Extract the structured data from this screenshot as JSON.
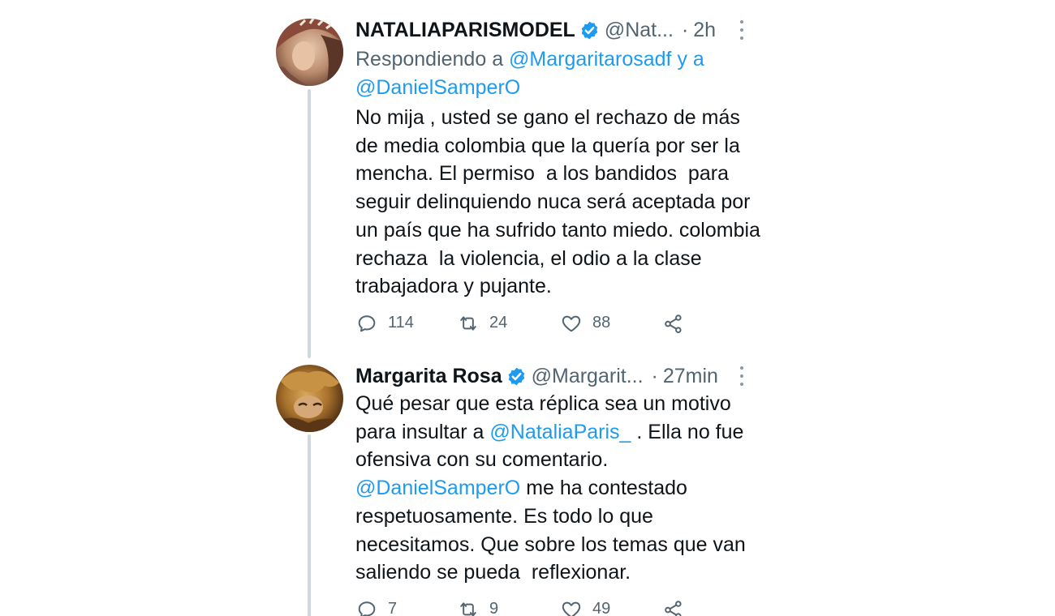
{
  "tweets": [
    {
      "name": "NATALIAPARISMODEL",
      "verified": true,
      "handle": "@Nat...",
      "separator": "·",
      "time": "2h",
      "replying_prefix": "Respondiendo a",
      "replying_mention_1": "@Margaritarosadf",
      "replying_conjunction": "y a",
      "replying_mention_2": "@DanielSamperO",
      "text": "No mija , usted se gano el rechazo de más de media colombia que la quería por ser la mencha. El permiso  a los bandidos  para seguir delinquiendo nuca será aceptada por un país que ha sufrido tanto miedo. colombia rechaza  la violencia, el odio a la clase trabajadora y pujante.",
      "stats": {
        "replies": "114",
        "retweets": "24",
        "likes": "88"
      }
    },
    {
      "name": "Margarita Rosa",
      "verified": true,
      "handle": "@Margarit...",
      "separator": "·",
      "time": "27min",
      "text_part_1": "Qué pesar que esta réplica sea un motivo para insultar a",
      "mention_1": "@NataliaParis_",
      "text_part_2": ". Ella no fue ofensiva con su comentario.",
      "mention_2": "@DanielSamperO",
      "text_part_3": "me ha contestado respetuosamente. Es todo lo que necesitamos. Que sobre los temas que van saliendo se pueda  reflexionar.",
      "stats": {
        "replies": "7",
        "retweets": "9",
        "likes": "49"
      }
    }
  ],
  "icons": {
    "reply": "reply-icon",
    "retweet": "retweet-icon",
    "like": "like-icon",
    "share": "share-icon",
    "verified": "verified-badge-icon",
    "more": "more-options-icon"
  },
  "colors": {
    "link": "#1d9bf0",
    "secondary_text": "#536471",
    "primary_text": "#0f1419",
    "thread_line": "#cfd9de",
    "verified": "#1d9bf0"
  }
}
